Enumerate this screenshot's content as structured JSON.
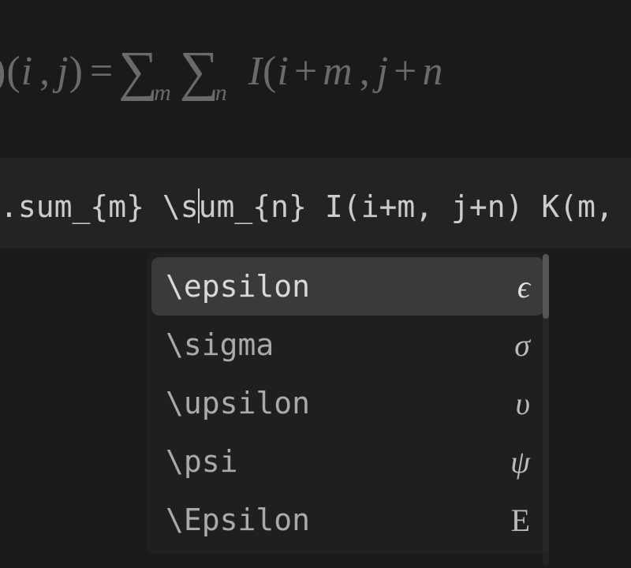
{
  "preview": {
    "formula_html": "<span class='paren'>)</span><span class='paren'>(</span>i<span class='op'>,</span>j<span class='paren'>)</span><span class='op'>=</span><span class='sum'>∑</span><span class='sub'>m</span><span class='sum'>∑</span><span class='sub'>n</span> I<span class='paren'>(</span>i<span class='plus'>+</span>m<span class='op'>,</span>j<span class='plus'>+</span>n"
  },
  "input": {
    "before_cursor": ".sum_{m} \\s",
    "after_cursor": "um_{n} I(i+m, j+n) K(m, n)"
  },
  "autocomplete": {
    "items": [
      {
        "command": "\\epsilon",
        "symbol": "ϵ",
        "selected": true,
        "upright": false
      },
      {
        "command": "\\sigma",
        "symbol": "σ",
        "selected": false,
        "upright": false
      },
      {
        "command": "\\upsilon",
        "symbol": "υ",
        "selected": false,
        "upright": false
      },
      {
        "command": "\\psi",
        "symbol": "ψ",
        "selected": false,
        "upright": false
      },
      {
        "command": "\\Epsilon",
        "symbol": "E",
        "selected": false,
        "upright": true
      }
    ]
  }
}
